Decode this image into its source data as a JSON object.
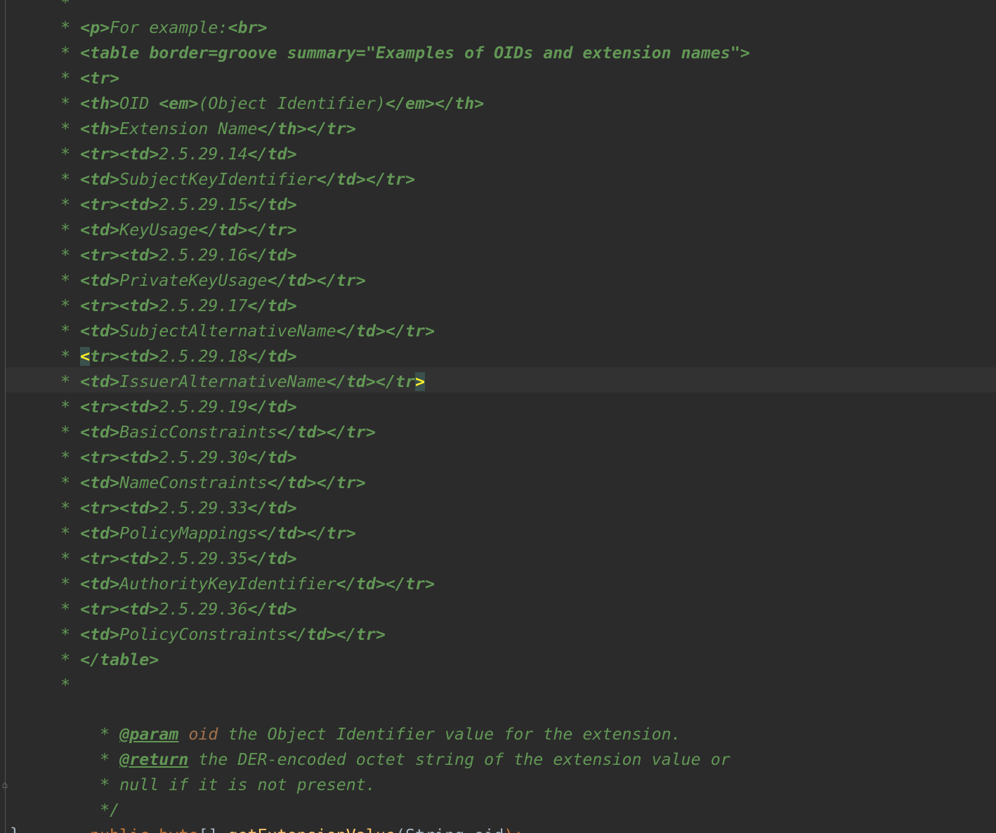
{
  "editor": {
    "comment_lines": [
      "*",
      "* <p>For example:<br>",
      "* <table border=groove summary=\"Examples of OIDs and extension names\">",
      "* <tr>",
      "* <th>OID <em>(Object Identifier)</em></th>",
      "* <th>Extension Name</th></tr>",
      "* <tr><td>2.5.29.14</td>",
      "* <td>SubjectKeyIdentifier</td></tr>",
      "* <tr><td>2.5.29.15</td>",
      "* <td>KeyUsage</td></tr>",
      "* <tr><td>2.5.29.16</td>",
      "* <td>PrivateKeyUsage</td></tr>",
      "* <tr><td>2.5.29.17</td>",
      "* <td>SubjectAlternativeName</td></tr>",
      "* <tr><td>2.5.29.18</td>",
      "* <td>IssuerAlternativeName</td></tr>",
      "* <tr><td>2.5.29.19</td>",
      "* <td>BasicConstraints</td></tr>",
      "* <tr><td>2.5.29.30</td>",
      "* <td>NameConstraints</td></tr>",
      "* <tr><td>2.5.29.33</td>",
      "* <td>PolicyMappings</td></tr>",
      "* <tr><td>2.5.29.35</td>",
      "* <td>AuthorityKeyIdentifier</td></tr>",
      "* <tr><td>2.5.29.36</td>",
      "* <td>PolicyConstraints</td></tr>",
      "* </table>",
      "*"
    ],
    "javadoc": {
      "param_tag": "@param",
      "param_name": "oid",
      "param_desc": " the Object Identifier value for the extension.",
      "return_tag": "@return",
      "return_desc": " the DER-encoded octet string of the extension value or",
      "continuation": "null if it is not present.",
      "close": "*/"
    },
    "signature": {
      "modifier": "public",
      "return_type": "byte",
      "brackets": "[]",
      "method_name": "getExtensionValue",
      "open_paren": "(",
      "param_type": "String",
      "param_name": "oid",
      "close": ");"
    },
    "closing_brace": "}",
    "fold_marker": "⌂"
  },
  "colors": {
    "background": "#2b2b2b",
    "current_line": "#323232",
    "doc_comment": "#629755",
    "keyword": "#cc7832",
    "identifier": "#a9b7c6",
    "method": "#ffc66d",
    "param_ref": "#a3724c",
    "brace_match": "#ffef28"
  }
}
